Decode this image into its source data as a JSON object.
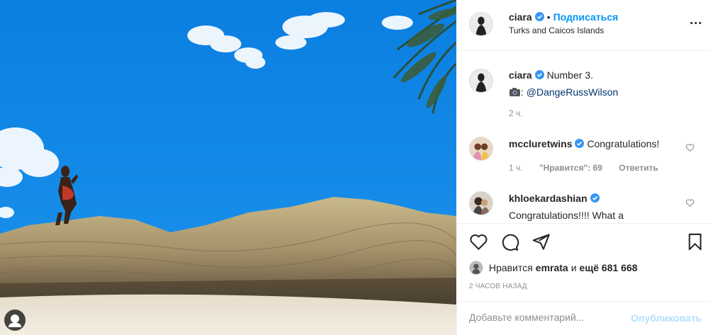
{
  "post": {
    "author": "ciara",
    "follow_label": "Подписаться",
    "dot": "•",
    "location": "Turks and Caicos Islands"
  },
  "caption": {
    "author": "ciara",
    "text": "Number 3.",
    "credit_prefix": ":",
    "credit_link": "@DangeRussWilson",
    "time": "2 ч."
  },
  "comments": [
    {
      "author": "mccluretwins",
      "text": "Congratulations!",
      "time": "1 ч.",
      "likes": "\"Нравится\": 69",
      "reply": "Ответить"
    },
    {
      "author": "khloekardashian",
      "text": "Congratulations!!!! What a"
    }
  ],
  "likes": {
    "prefix": "Нравится",
    "user": "emrata",
    "and_more": "и",
    "count": "ещё 681 668"
  },
  "timestamp": "2 часов назад",
  "add_comment": {
    "placeholder": "Добавьте комментарий...",
    "publish_label": "Опубликовать"
  },
  "colors": {
    "accent": "#0095f6",
    "verified": "#3897f0",
    "sky": "#0f86e6",
    "publish_disabled": "#b2dffc"
  },
  "icons": [
    "verified-badge-icon",
    "more-options-icon",
    "camera-emoji-icon",
    "like-heart-icon",
    "comment-icon",
    "share-icon",
    "bookmark-icon"
  ]
}
